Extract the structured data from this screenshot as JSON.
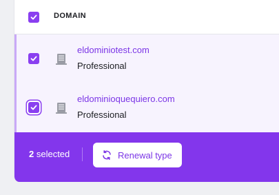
{
  "header": {
    "column_label": "DOMAIN"
  },
  "rows": [
    {
      "domain": "eldominiotest.com",
      "plan": "Professional"
    },
    {
      "domain": "eldominioquequiero.com",
      "plan": "Professional"
    }
  ],
  "action_bar": {
    "count": "2",
    "selected_label": " selected",
    "renewal_label": "Renewal type"
  },
  "colors": {
    "accent": "#8336ec",
    "row_bg": "#f7f3fe",
    "link": "#7b35e6"
  },
  "icons": {
    "row_icon": "server-icon",
    "renewal_icon": "refresh-icon",
    "checkbox": "check-icon"
  }
}
